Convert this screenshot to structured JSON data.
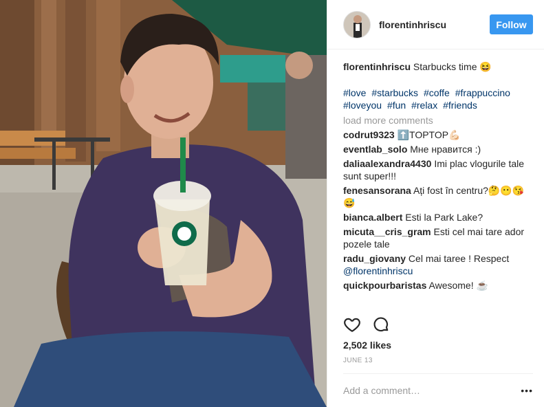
{
  "post": {
    "username": "florentinhriscu",
    "follow_label": "Follow",
    "caption": "Starbucks time 😆",
    "hashtags": [
      "#love",
      "#starbucks",
      "#coffe",
      "#frappuccino",
      "#loveyou",
      "#fun",
      "#relax",
      "#friends"
    ],
    "load_more": "load more comments",
    "likes": "2,502 likes",
    "date": "JUNE 13",
    "add_comment_placeholder": "Add a comment…"
  },
  "comments": [
    {
      "user": "codrut9323",
      "text": "⬆️TOPTOP💪🏻"
    },
    {
      "user": "eventlab_solo",
      "text": "Мне нравится :)"
    },
    {
      "user": "daliaalexandra4430",
      "text": "Imi plac vlogurile tale sunt super!!!"
    },
    {
      "user": "fenesansorana",
      "text": "Ați fost în centru?🤔😶😘😅"
    },
    {
      "user": "bianca.albert",
      "text": "Esti la Park Lake?"
    },
    {
      "user": "micuta__cris_gram",
      "text": "Esti cel mai tare ador pozele tale"
    },
    {
      "user": "radu_giovany",
      "text": "Cel mai taree ! Respect",
      "mention": "@florentinhriscu"
    },
    {
      "user": "quickpourbaristas",
      "text": "Awesome! ☕️"
    }
  ],
  "icons": {
    "like": "heart-icon",
    "comment": "comment-bubble-icon",
    "more": "more-options-icon"
  },
  "colors": {
    "follow_button": "#3897f0",
    "hashtag": "#003569",
    "muted": "#999999"
  }
}
